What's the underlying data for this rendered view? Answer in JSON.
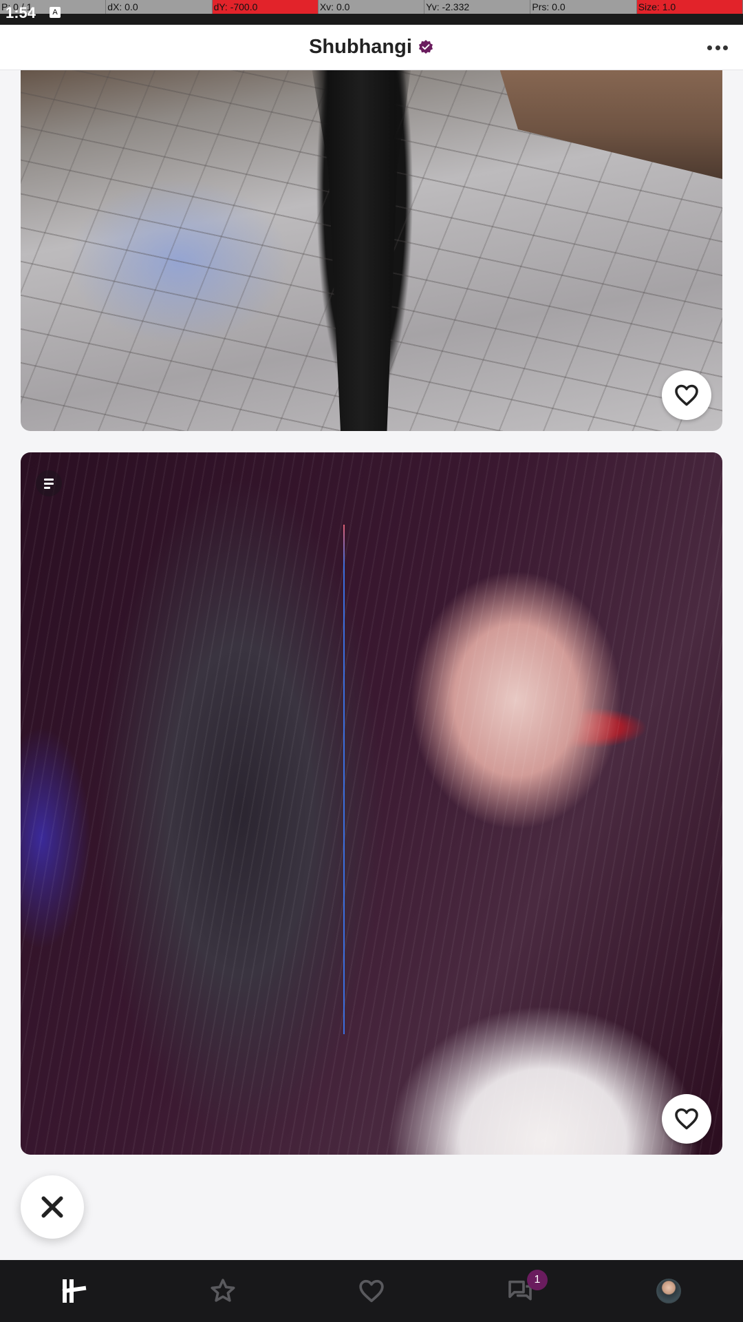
{
  "debug_overlay": {
    "cells": [
      {
        "text": "P: 0 / 1",
        "highlight": false
      },
      {
        "text": "dX: 0.0",
        "highlight": false
      },
      {
        "text": "dY: -700.0",
        "highlight": true
      },
      {
        "text": "Xv: 0.0",
        "highlight": false
      },
      {
        "text": "Yv: -2.332",
        "highlight": false
      },
      {
        "text": "Prs: 0.0",
        "highlight": false
      },
      {
        "text": "Size: 1.0",
        "highlight": true
      }
    ]
  },
  "status_bar": {
    "time": "1:54",
    "notification_icon": "A"
  },
  "header": {
    "title": "Shubhangi",
    "verified_icon": "verified-badge-icon",
    "more_icon": "more-horizontal-icon"
  },
  "photos": [
    {
      "name": "photo-1",
      "description_icon": null,
      "like_icon": "heart-outline-icon"
    },
    {
      "name": "photo-2",
      "description_icon": "text-lines-icon",
      "like_icon": "heart-outline-icon"
    }
  ],
  "pass_button": {
    "icon": "close-x-icon"
  },
  "bottom_nav": {
    "items": [
      {
        "name": "discover",
        "icon": "hinge-logo-icon"
      },
      {
        "name": "standouts",
        "icon": "star-outline-icon"
      },
      {
        "name": "likes",
        "icon": "heart-outline-icon"
      },
      {
        "name": "matches",
        "icon": "chat-bubbles-icon",
        "badge": "1"
      },
      {
        "name": "profile",
        "icon": "avatar"
      }
    ]
  },
  "colors": {
    "accent": "#6a1c5e",
    "nav_background": "#18181a",
    "header_background": "#ffffff",
    "page_background": "#f5f5f7"
  }
}
